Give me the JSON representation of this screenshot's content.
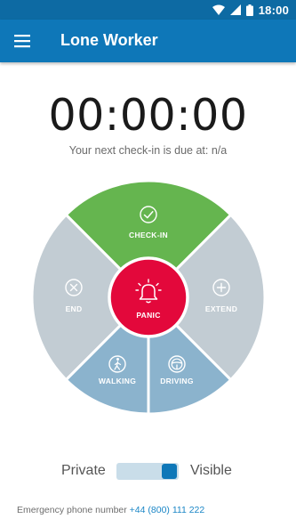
{
  "status_bar": {
    "time": "18:00",
    "icons": [
      "wifi-icon",
      "signal-icon",
      "battery-icon"
    ]
  },
  "app_bar": {
    "title": "Lone Worker",
    "menu_icon": "hamburger-menu-icon"
  },
  "timer": {
    "value": "00:00:00",
    "next_checkin": "Your next check-in is due at: n/a"
  },
  "wheel": {
    "checkin": {
      "label": "CHECK-IN",
      "icon": "check-circle-icon",
      "color": "#65b54f"
    },
    "end": {
      "label": "END",
      "icon": "close-circle-icon",
      "color": "#c2ccd3"
    },
    "extend": {
      "label": "EXTEND",
      "icon": "plus-circle-icon",
      "color": "#c2ccd3"
    },
    "walking": {
      "label": "WALKING",
      "icon": "walking-person-icon",
      "color": "#8bb3cd"
    },
    "driving": {
      "label": "DRIVING",
      "icon": "steering-wheel-icon",
      "color": "#8bb3cd"
    },
    "panic": {
      "label": "PANIC",
      "icon": "alarm-bell-icon",
      "color": "#e3083b"
    }
  },
  "privacy": {
    "private_label": "Private",
    "visible_label": "Visible",
    "state": "visible"
  },
  "emergency": {
    "text": "Emergency phone number",
    "number": "+44 (800) 111 222"
  },
  "colors": {
    "status_bar": "#0d6aa3",
    "app_bar": "#0e77b8",
    "accent": "#0e77b8",
    "link": "#1b86c6"
  }
}
